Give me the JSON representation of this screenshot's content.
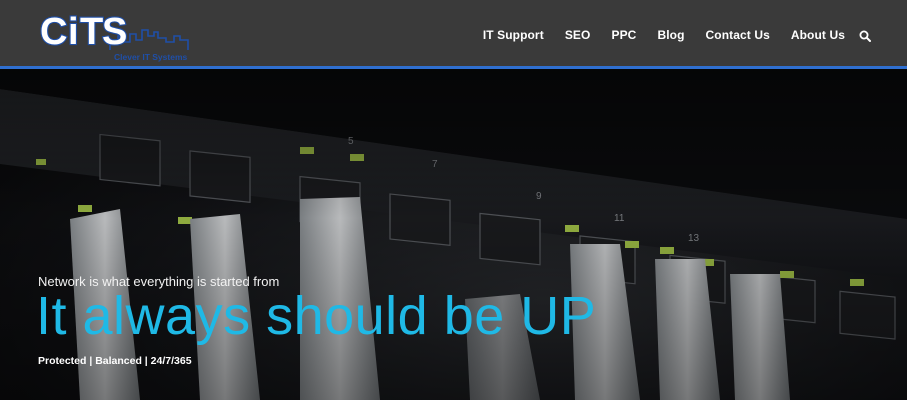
{
  "brand": {
    "logo_text": "CITS",
    "logo_subtext": "Clever IT Systems",
    "accent_color": "#2f6fd0",
    "logo_color": "#1f4fa8"
  },
  "nav": {
    "items": [
      {
        "label": "IT Support"
      },
      {
        "label": "SEO"
      },
      {
        "label": "PPC"
      },
      {
        "label": "Blog"
      },
      {
        "label": "Contact Us"
      },
      {
        "label": "About Us"
      }
    ],
    "search_icon": "search-icon"
  },
  "hero": {
    "subtitle": "Network is what everything is started from",
    "title": "It always should be UP",
    "tagline": "Protected | Balanced | 24/7/365",
    "title_color": "#1fb9e6"
  }
}
